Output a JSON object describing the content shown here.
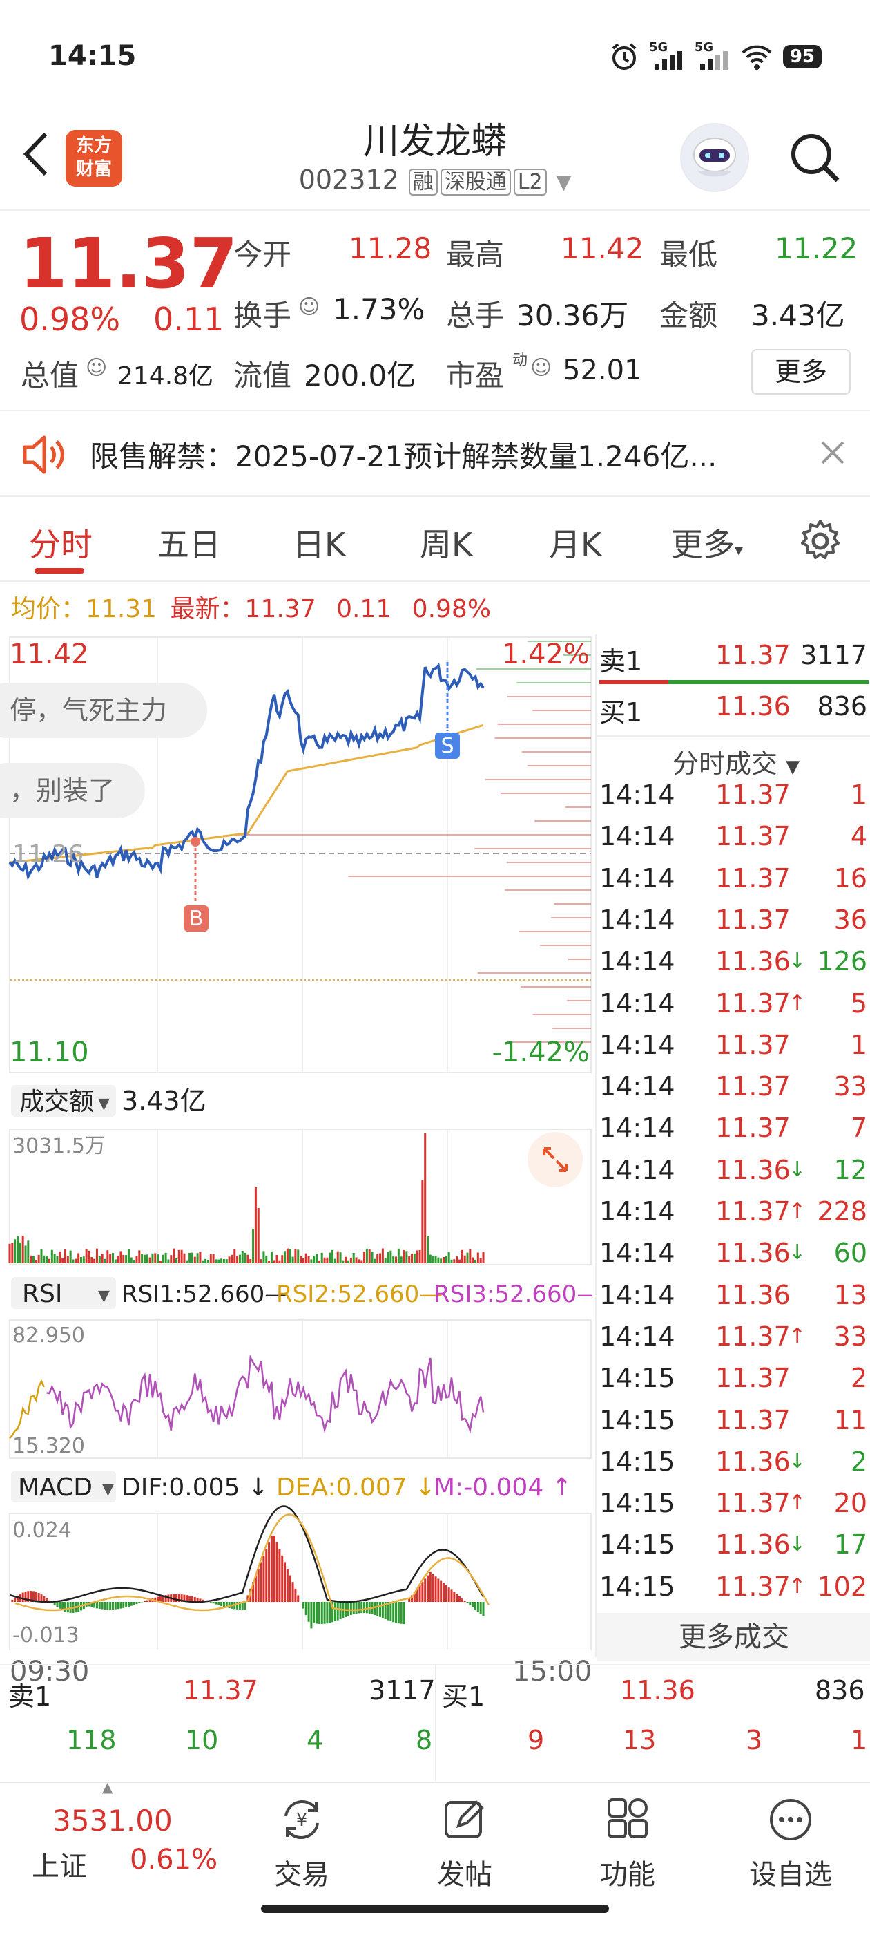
{
  "status_bar": {
    "time": "14:15",
    "net1": "5G",
    "net2": "5G",
    "battery": "95"
  },
  "header": {
    "logo_line1": "东方",
    "logo_line2": "财富",
    "stock_name": "川发龙蟒",
    "stock_code": "002312",
    "tags": [
      "融",
      "深股通",
      "L2"
    ]
  },
  "quote": {
    "price": "11.37",
    "change_pct": "0.98%",
    "change": "0.11",
    "open_label": "今开",
    "open": "11.28",
    "high_label": "最高",
    "high": "11.42",
    "low_label": "最低",
    "low": "11.22",
    "turnover_label": "换手",
    "turnover": "1.73%",
    "volume_label": "总手",
    "volume": "30.36万",
    "amount_label": "金额",
    "amount": "3.43亿",
    "mktcap_label": "总值",
    "mktcap": "214.8亿",
    "float_label": "流值",
    "float": "200.0亿",
    "pe_label": "市盈",
    "pe_sup": "动",
    "pe": "52.01",
    "more_label": "更多"
  },
  "notice": {
    "text": "限售解禁：2025-07-21预计解禁数量1.246亿..."
  },
  "tabs": [
    "分时",
    "五日",
    "日K",
    "周K",
    "月K",
    "更多"
  ],
  "avg_bar": {
    "avg_label": "均价：",
    "avg": "11.31",
    "last_label": "最新：",
    "last": "11.37",
    "chg": "0.11",
    "pct": "0.98%"
  },
  "intraday": {
    "y_high": "11.42",
    "y_low": "11.10",
    "y_mid": "11.26",
    "pct_high": "1.42%",
    "pct_low": "-1.42%",
    "comment1": "停，气死主力",
    "comment2": "，别装了",
    "buy_marker": "B",
    "sell_marker": "S"
  },
  "volume_panel": {
    "selector": "成交额",
    "total": "3.43亿",
    "ymax": "3031.5万"
  },
  "rsi_panel": {
    "selector": "RSI",
    "rsi1": "RSI1:52.660—",
    "rsi2": "RSI2:52.660—",
    "rsi3": "RSI3:52.660—",
    "ymax": "82.950",
    "ymin": "15.320"
  },
  "macd_panel": {
    "selector": "MACD",
    "dif": "DIF:0.005 ↓",
    "dea": "DEA:0.007 ↓",
    "m": "M:-0.004 ↑",
    "ymax": "0.024",
    "ymin": "-0.013"
  },
  "time_axis": {
    "start": "09:30",
    "end": "15:00"
  },
  "order_book_top": {
    "ask_label": "卖1",
    "ask_price": "11.37",
    "ask_vol": "3117",
    "bid_label": "买1",
    "bid_price": "11.36",
    "bid_vol": "836"
  },
  "ticks_header": "分时成交",
  "ticks": [
    {
      "t": "14:14",
      "p": "11.37",
      "v": "1",
      "d": ""
    },
    {
      "t": "14:14",
      "p": "11.37",
      "v": "4",
      "d": ""
    },
    {
      "t": "14:14",
      "p": "11.37",
      "v": "16",
      "d": ""
    },
    {
      "t": "14:14",
      "p": "11.37",
      "v": "36",
      "d": ""
    },
    {
      "t": "14:14",
      "p": "11.36",
      "v": "126",
      "d": "down"
    },
    {
      "t": "14:14",
      "p": "11.37",
      "v": "5",
      "d": "up"
    },
    {
      "t": "14:14",
      "p": "11.37",
      "v": "1",
      "d": ""
    },
    {
      "t": "14:14",
      "p": "11.37",
      "v": "33",
      "d": ""
    },
    {
      "t": "14:14",
      "p": "11.37",
      "v": "7",
      "d": ""
    },
    {
      "t": "14:14",
      "p": "11.36",
      "v": "12",
      "d": "down"
    },
    {
      "t": "14:14",
      "p": "11.37",
      "v": "228",
      "d": "up"
    },
    {
      "t": "14:14",
      "p": "11.36",
      "v": "60",
      "d": "down"
    },
    {
      "t": "14:14",
      "p": "11.36",
      "v": "13",
      "d": ""
    },
    {
      "t": "14:14",
      "p": "11.37",
      "v": "33",
      "d": "up"
    },
    {
      "t": "14:15",
      "p": "11.37",
      "v": "2",
      "d": ""
    },
    {
      "t": "14:15",
      "p": "11.37",
      "v": "11",
      "d": ""
    },
    {
      "t": "14:15",
      "p": "11.36",
      "v": "2",
      "d": "down"
    },
    {
      "t": "14:15",
      "p": "11.37",
      "v": "20",
      "d": "up"
    },
    {
      "t": "14:15",
      "p": "11.36",
      "v": "17",
      "d": "down"
    },
    {
      "t": "14:15",
      "p": "11.37",
      "v": "102",
      "d": "up"
    }
  ],
  "more_ticks": "更多成交",
  "bottom_book": {
    "ask_label": "卖1",
    "ask_price": "11.37",
    "ask_vol": "3117",
    "bid_label": "买1",
    "bid_price": "11.36",
    "bid_vol": "836",
    "ask_row": [
      "118",
      "10",
      "4",
      "8"
    ],
    "bid_row": [
      "9",
      "13",
      "3",
      "1"
    ]
  },
  "nav": {
    "index_value": "3531.00",
    "index_name": "上证",
    "index_pct": "0.61%",
    "items": [
      "交易",
      "发帖",
      "功能",
      "设自选"
    ]
  }
}
